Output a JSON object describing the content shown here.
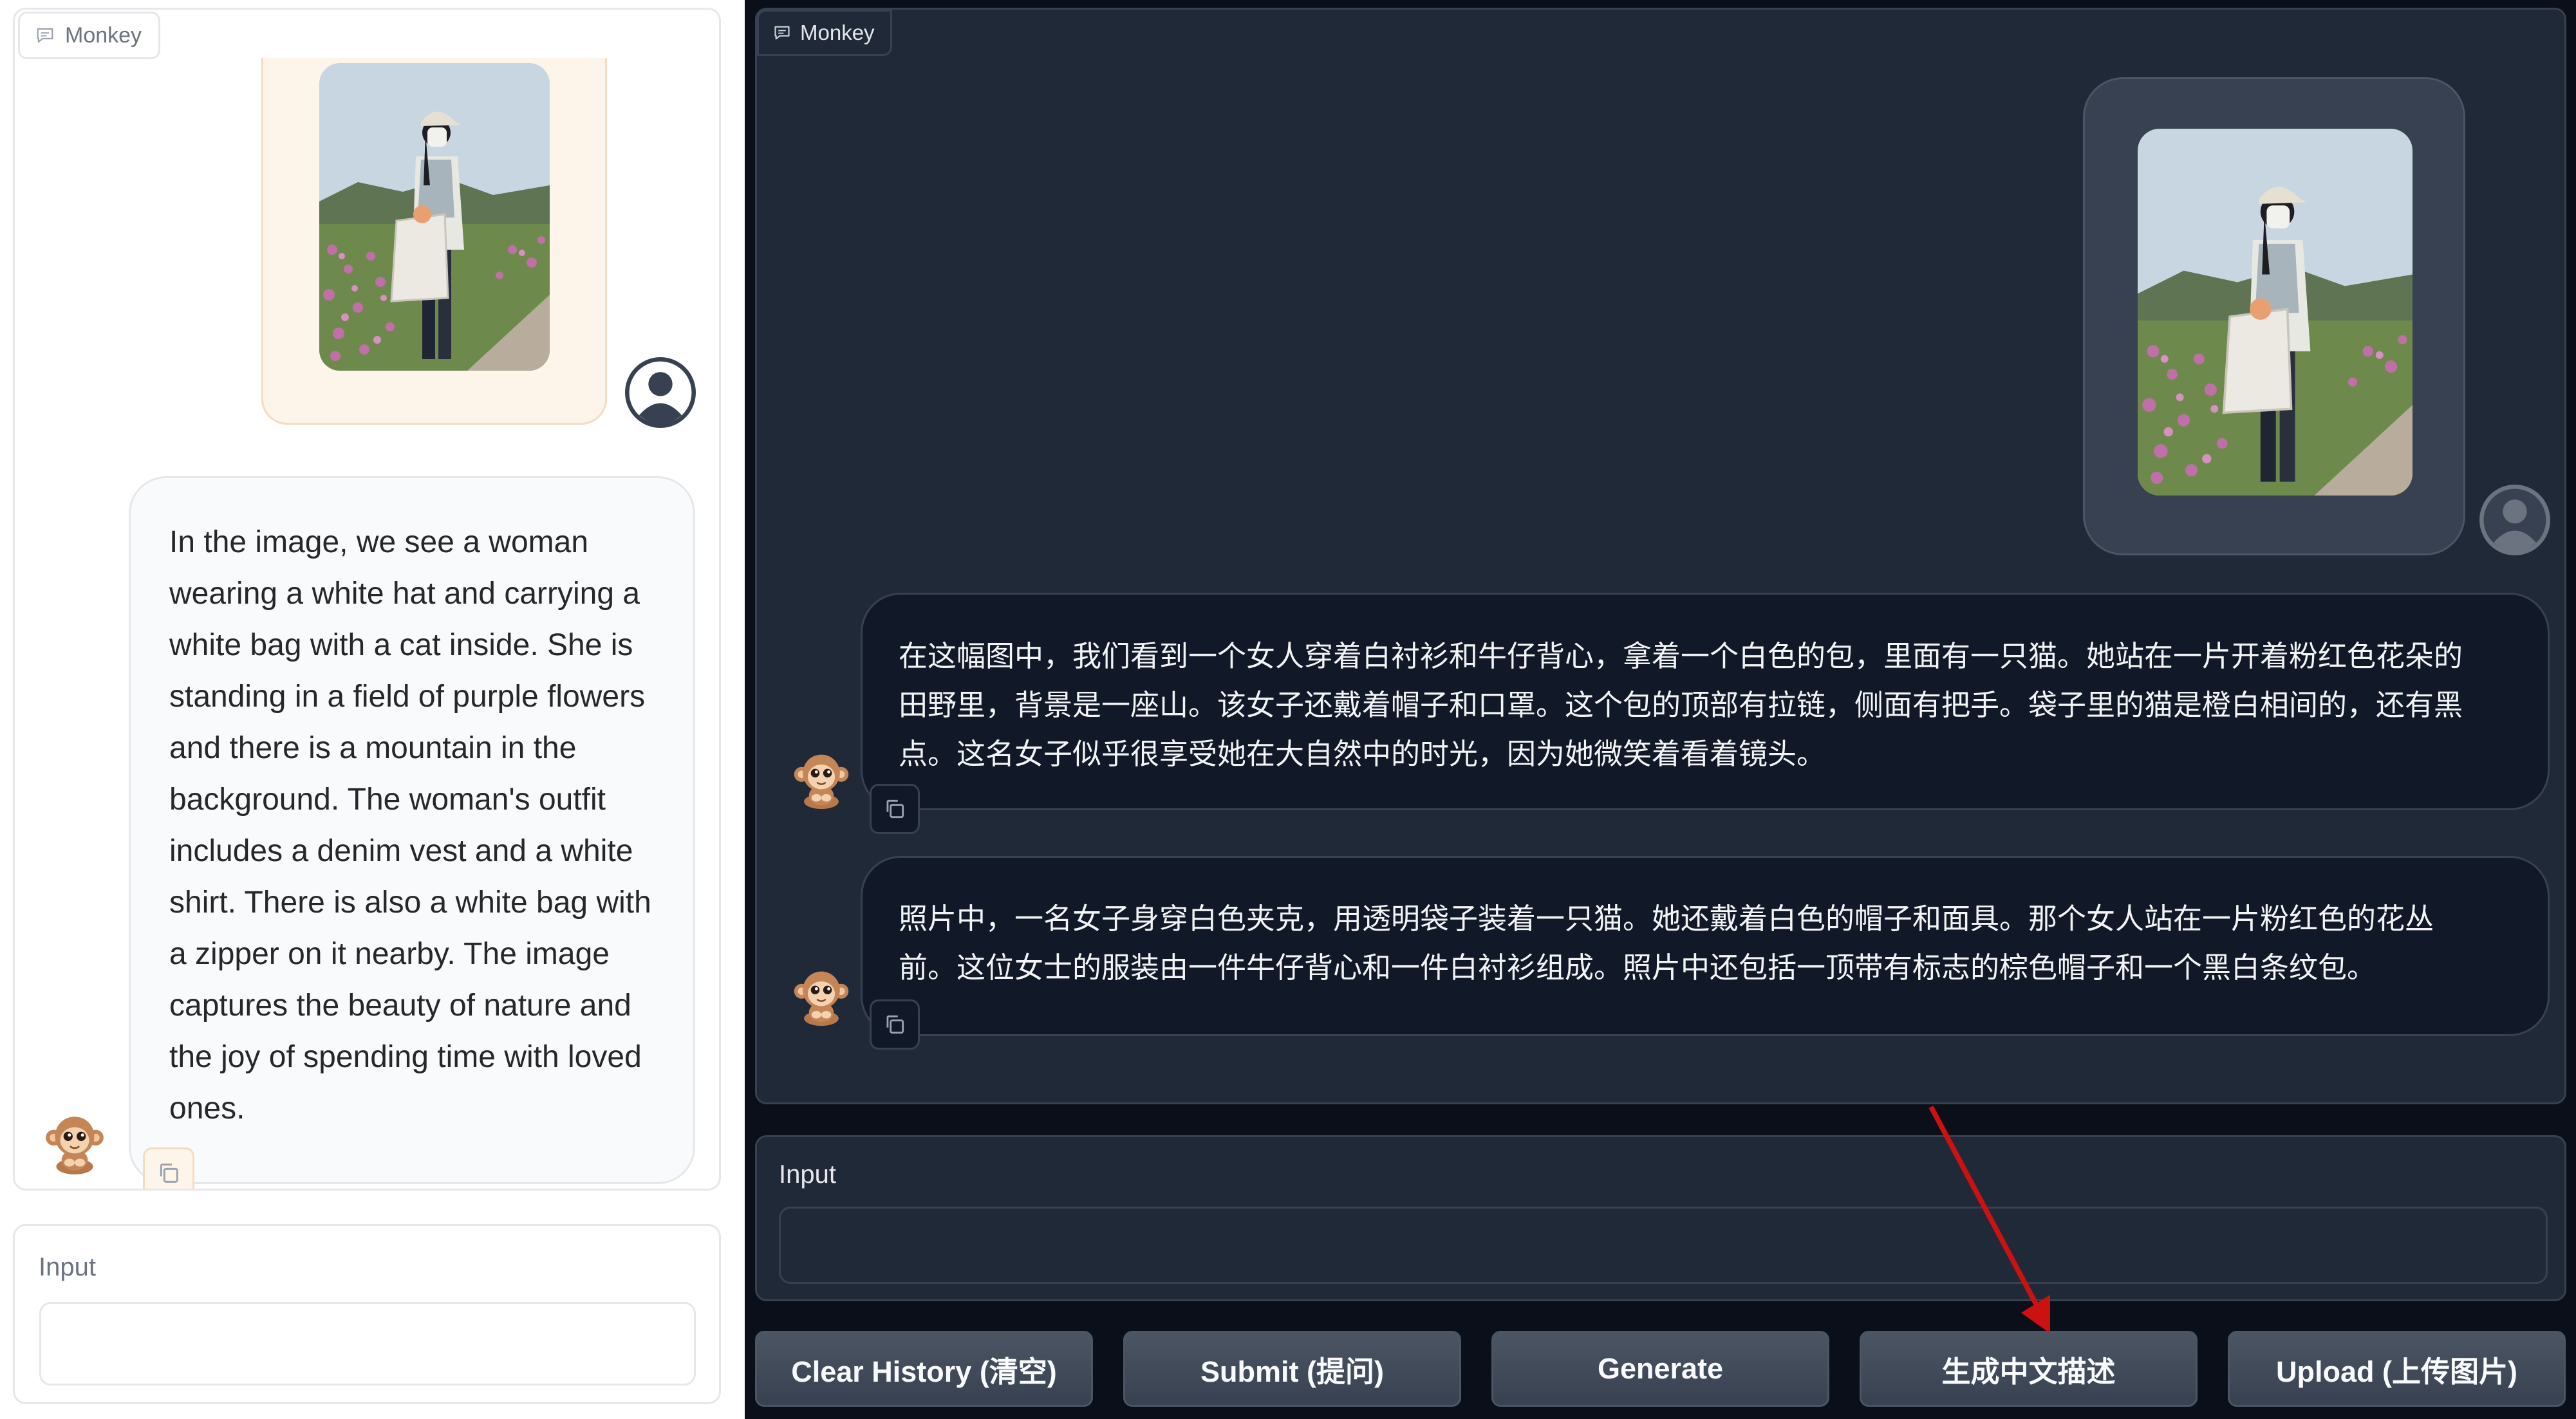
{
  "light_panel": {
    "chatbot_label": "Monkey",
    "bot_message": "In the image, we see a woman wearing a white hat and carrying a white bag with a cat inside. She is standing in a field of purple flowers and there is a mountain in the background. The woman's outfit includes a denim vest and a white shirt. There is also a white bag with a zipper on it nearby. The image captures the beauty of nature and the joy of spending time with loved ones.",
    "input_label": "Input",
    "input_value": ""
  },
  "dark_panel": {
    "chatbot_label": "Monkey",
    "bot_messages": [
      "在这幅图中，我们看到一个女人穿着白衬衫和牛仔背心，拿着一个白色的包，里面有一只猫。她站在一片开着粉红色花朵的田野里，背景是一座山。该女子还戴着帽子和口罩。这个包的顶部有拉链，侧面有把手。袋子里的猫是橙白相间的，还有黑点。这名女子似乎很享受她在大自然中的时光，因为她微笑着看着镜头。",
      "照片中，一名女子身穿白色夹克，用透明袋子装着一只猫。她还戴着白色的帽子和面具。那个女人站在一片粉红色的花丛前。这位女士的服装由一件牛仔背心和一件白衬衫组成。照片中还包括一顶带有标志的棕色帽子和一个黑白条纹包。"
    ],
    "input_label": "Input",
    "input_value": "",
    "buttons": {
      "clear": "Clear History (清空)",
      "submit": "Submit (提问)",
      "generate": "Generate",
      "chinese": "生成中文描述",
      "upload": "Upload (上传图片)"
    }
  },
  "colors": {
    "light_user_bubble": "#fdf5ea",
    "dark_background": "#0b0f19",
    "dark_panel": "#1f2937",
    "dark_bubble": "#111827",
    "annotation_arrow": "#cc1111"
  },
  "icons": {
    "label_icon": "chat-bubble-icon",
    "copy_icon": "copy-icon",
    "user_avatar": "user-avatar-icon",
    "bot_avatar": "monkey-avatar-icon"
  }
}
